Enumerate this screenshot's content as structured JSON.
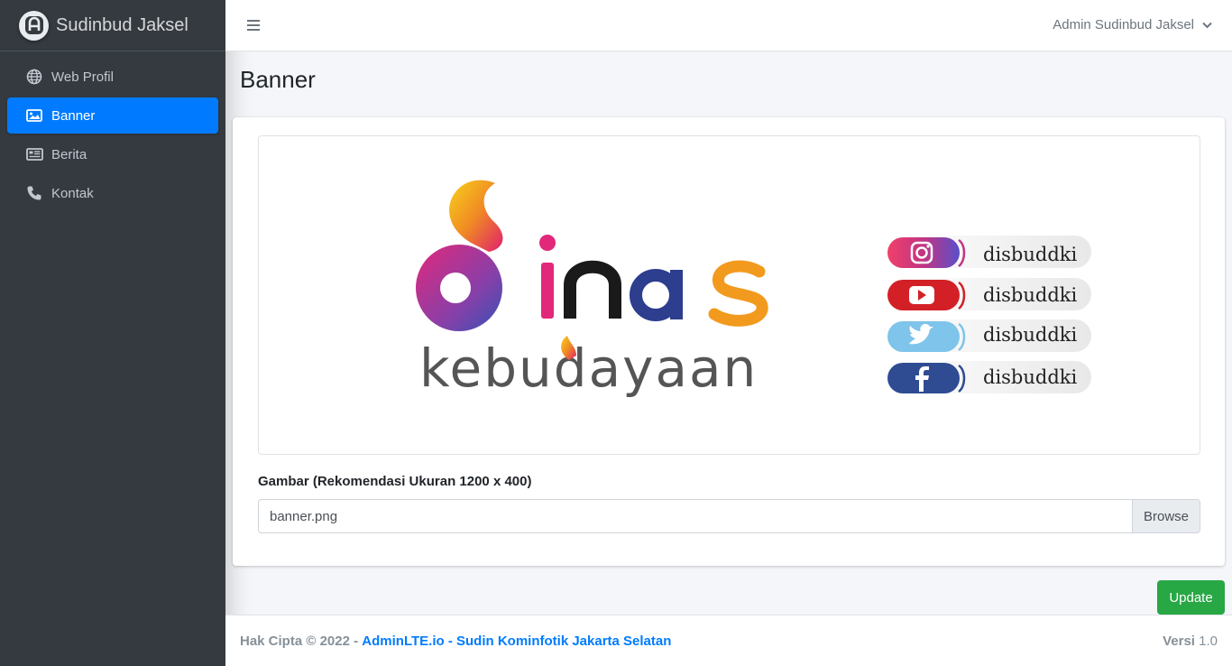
{
  "brand": {
    "name": "Sudinbud Jaksel"
  },
  "sidebar": {
    "items": [
      {
        "label": "Web Profil",
        "icon": "globe-icon"
      },
      {
        "label": "Banner",
        "icon": "image-icon",
        "active": true
      },
      {
        "label": "Berita",
        "icon": "newspaper-icon"
      },
      {
        "label": "Kontak",
        "icon": "phone-icon"
      }
    ]
  },
  "header": {
    "user": "Admin Sudinbud Jaksel"
  },
  "page": {
    "title": "Banner"
  },
  "banner": {
    "logo_word": "inas",
    "logo_sub": "kebudayaan",
    "social": [
      {
        "network": "instagram",
        "handle": "disbuddki"
      },
      {
        "network": "youtube",
        "handle": "disbuddki"
      },
      {
        "network": "twitter",
        "handle": "disbuddki"
      },
      {
        "network": "facebook",
        "handle": "disbuddki"
      }
    ]
  },
  "form": {
    "label": "Gambar (Rekomendasi Ukuran 1200 x 400)",
    "file_value": "banner.png",
    "browse_label": "Browse",
    "submit_label": "Update"
  },
  "footer": {
    "copyright": "Hak Cipta © 2022 -",
    "link1": "AdminLTE.io",
    "sep": "-",
    "link2": "Sudin Kominfotik Jakarta Selatan",
    "version_label": "Versi",
    "version": "1.0"
  },
  "colors": {
    "sidebar_bg": "#343a40",
    "primary": "#007bff",
    "success": "#28a745",
    "body_bg": "#f4f6f9"
  }
}
